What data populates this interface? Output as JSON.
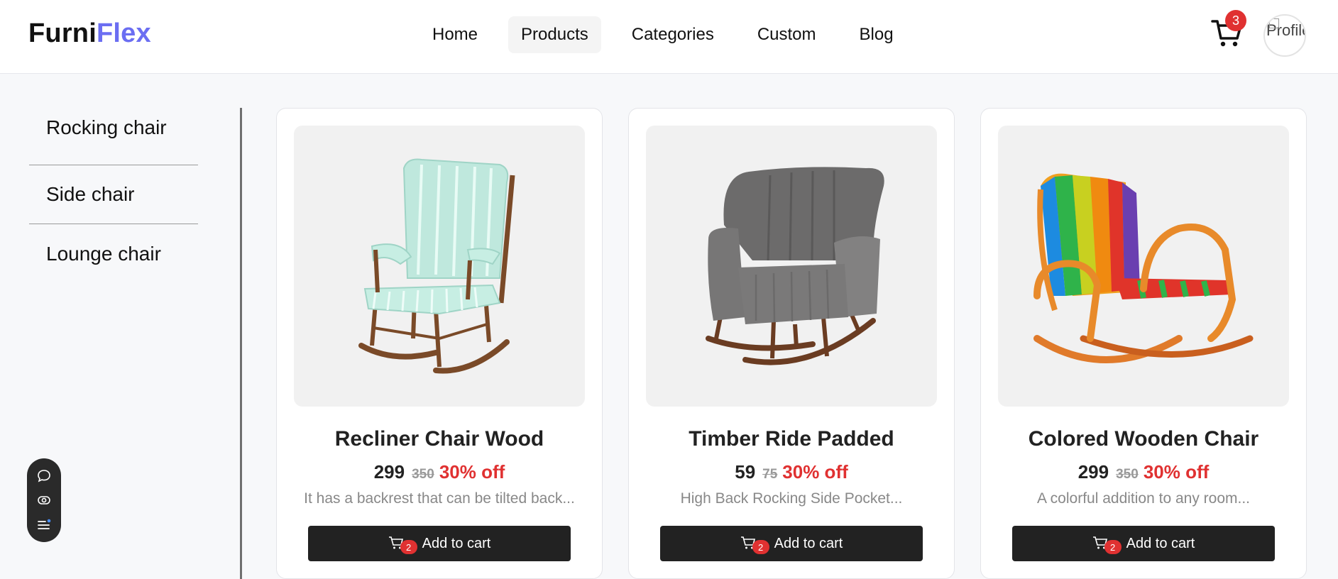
{
  "brand": {
    "part1": "Furni",
    "part2": "Flex"
  },
  "nav": [
    {
      "label": "Home"
    },
    {
      "label": "Products"
    },
    {
      "label": "Categories"
    },
    {
      "label": "Custom"
    },
    {
      "label": "Blog"
    }
  ],
  "nav_active": "Products",
  "cart": {
    "count": "3",
    "icon": "cart-icon"
  },
  "profile": {
    "alt": "Profile"
  },
  "sidebar": {
    "items": [
      {
        "label": "Rocking chair"
      },
      {
        "label": "Side chair"
      },
      {
        "label": "Lounge chair"
      }
    ]
  },
  "floating_toolbar": {
    "icons": [
      "chat-icon",
      "eye-icon",
      "menu-icon"
    ]
  },
  "products": [
    {
      "title": "Recliner Chair Wood",
      "price": "299",
      "old_price": "350",
      "discount": "30% off",
      "desc": "It has a backrest that can be tilted back...",
      "button": "Add to cart",
      "btn_badge": "2"
    },
    {
      "title": "Timber Ride Padded",
      "price": "59",
      "old_price": "75",
      "discount": "30% off",
      "desc": "High Back Rocking Side Pocket...",
      "button": "Add to cart",
      "btn_badge": "2"
    },
    {
      "title": "Colored Wooden Chair",
      "price": "299",
      "old_price": "350",
      "discount": "30% off",
      "desc": "A colorful addition to any room...",
      "button": "Add to cart",
      "btn_badge": "2"
    }
  ],
  "colors": {
    "brand_accent": "#6b6ef2",
    "discount": "#e03131",
    "button": "#222222"
  }
}
